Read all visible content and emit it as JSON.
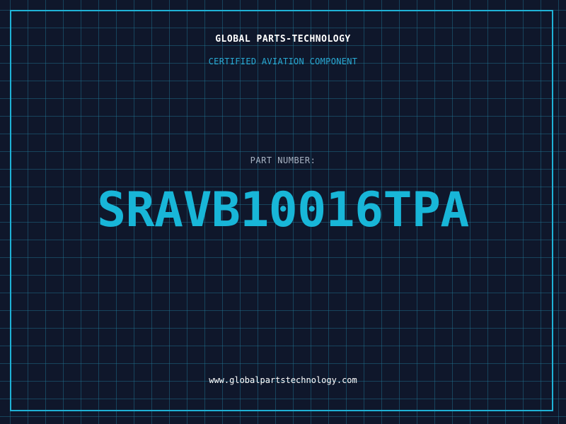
{
  "header": {
    "company": "GLOBAL PARTS-TECHNOLOGY",
    "subtitle": "CERTIFIED AVIATION COMPONENT"
  },
  "part": {
    "label": "PART NUMBER:",
    "number": "SRAVB10016TPA"
  },
  "footer": {
    "url": "www.globalpartstechnology.com"
  },
  "colors": {
    "background": "#0f172b",
    "grid": "#22789a",
    "accent": "#18b6d8",
    "subtitle": "#29a9d3",
    "label": "#a9b4c4",
    "text": "#ffffff"
  }
}
